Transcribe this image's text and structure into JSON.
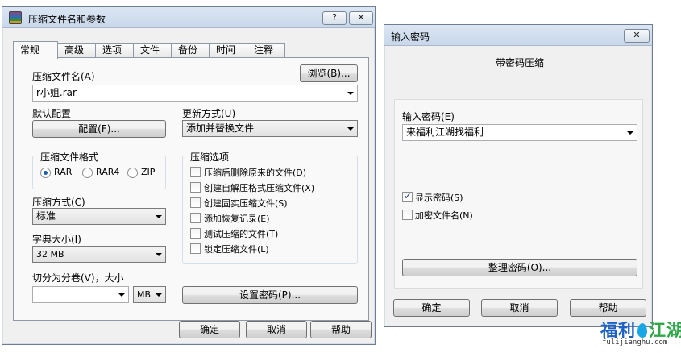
{
  "main_dialog": {
    "title": "压缩文件名和参数",
    "help_btn": "?",
    "close_btn": "✕",
    "tabs": [
      "常规",
      "高级",
      "选项",
      "文件",
      "备份",
      "时间",
      "注释"
    ],
    "archive_name_label": "压缩文件名(A)",
    "browse_btn": "浏览(B)...",
    "archive_name_value": "r小姐.rar",
    "default_profile_label": "默认配置",
    "profile_btn": "配置(F)...",
    "update_mode_label": "更新方式(U)",
    "update_mode_value": "添加并替换文件",
    "format_group": "压缩文件格式",
    "formats": [
      {
        "label": "RAR",
        "selected": true
      },
      {
        "label": "RAR4",
        "selected": false
      },
      {
        "label": "ZIP",
        "selected": false
      }
    ],
    "method_label": "压缩方式(C)",
    "method_value": "标准",
    "dict_label": "字典大小(I)",
    "dict_value": "32 MB",
    "split_label": "切分为分卷(V)，大小",
    "split_value": "",
    "split_unit": "MB",
    "options_group": "压缩选项",
    "options": [
      {
        "label": "压缩后删除原来的文件(D)",
        "checked": false
      },
      {
        "label": "创建自解压格式压缩文件(X)",
        "checked": false
      },
      {
        "label": "创建固实压缩文件(S)",
        "checked": false
      },
      {
        "label": "添加恢复记录(E)",
        "checked": false
      },
      {
        "label": "测试压缩的文件(T)",
        "checked": false
      },
      {
        "label": "锁定压缩文件(L)",
        "checked": false
      }
    ],
    "set_password_btn": "设置密码(P)...",
    "ok_btn": "确定",
    "cancel_btn": "取消",
    "help_text_btn": "帮助"
  },
  "password_dialog": {
    "title": "输入密码",
    "close_btn": "✕",
    "heading": "带密码压缩",
    "password_label": "输入密码(E)",
    "password_value": "来福利江湖找福利",
    "show_password": {
      "label": "显示密码(S)",
      "checked": true
    },
    "encrypt_names": {
      "label": "加密文件名(N)",
      "checked": false
    },
    "organize_btn": "整理密码(O)...",
    "ok_btn": "确定",
    "cancel_btn": "取消",
    "help_btn": "帮助"
  },
  "watermark": {
    "text_a": "福利",
    "text_b": "江湖",
    "url": "fulijianghu.com"
  }
}
